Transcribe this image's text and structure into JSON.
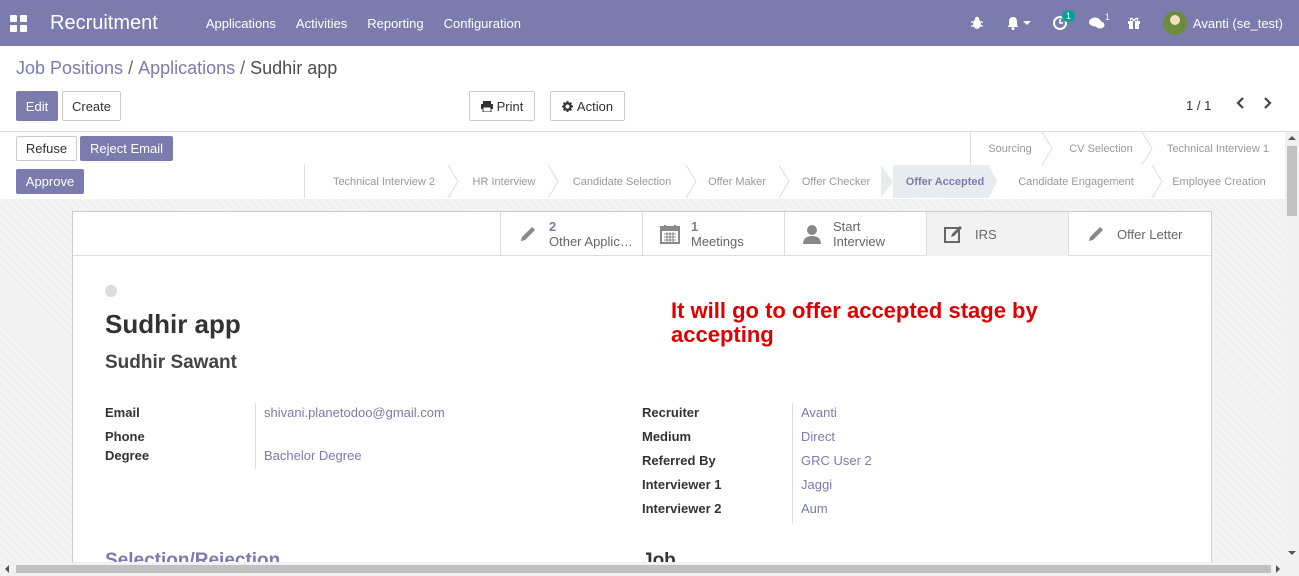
{
  "navbar": {
    "brand": "Recruitment",
    "menu": [
      "Applications",
      "Activities",
      "Reporting",
      "Configuration"
    ],
    "activity_badge": "1",
    "messages_badge": "1",
    "user": "Avanti (se_test)"
  },
  "breadcrumb": {
    "job_positions": "Job Positions",
    "applications": "Applications",
    "current": "Sudhir app",
    "sep": "/"
  },
  "toolbar": {
    "edit": "Edit",
    "create": "Create",
    "print": "Print",
    "action": "Action",
    "pager": "1 / 1"
  },
  "statusbar": {
    "refuse": "Refuse",
    "reject_email": "Reject Email",
    "approve": "Approve",
    "stages_row1": [
      "Sourcing",
      "CV Selection",
      "Technical Interview 1"
    ],
    "stages_row2": [
      "Technical Interview 2",
      "HR Interview",
      "Candidate Selection",
      "Offer Maker",
      "Offer Checker",
      "Offer Accepted",
      "Candidate Engagement",
      "Employee Creation"
    ],
    "active_stage": "Offer Accepted"
  },
  "smart_buttons": {
    "other_apps_count": "2",
    "other_apps_label": "Other Applic…",
    "meetings_count": "1",
    "meetings_label": "Meetings",
    "start_label_1": "Start",
    "start_label_2": "Interview",
    "irs": "IRS",
    "offer_letter": "Offer Letter"
  },
  "form": {
    "title": "Sudhir app",
    "candidate": "Sudhir Sawant",
    "note": "It will go to offer accepted stage by accepting",
    "left_fields": [
      {
        "label": "Email",
        "value": "shivani.planetodoo@gmail.com"
      },
      {
        "label": "Phone",
        "value": ""
      },
      {
        "label": "Degree",
        "value": "Bachelor Degree"
      }
    ],
    "right_fields": [
      {
        "label": "Recruiter",
        "value": "Avanti"
      },
      {
        "label": "Medium",
        "value": "Direct"
      },
      {
        "label": "Referred By",
        "value": "GRC User 2"
      },
      {
        "label": "Interviewer 1",
        "value": "Jaggi"
      },
      {
        "label": "Interviewer 2",
        "value": "Aum"
      }
    ],
    "section_left": "Selection/Rejection",
    "section_right": "Job"
  },
  "colors": {
    "brand": "#7c7bad",
    "note": "#e00000",
    "badge": "#00a09d"
  }
}
